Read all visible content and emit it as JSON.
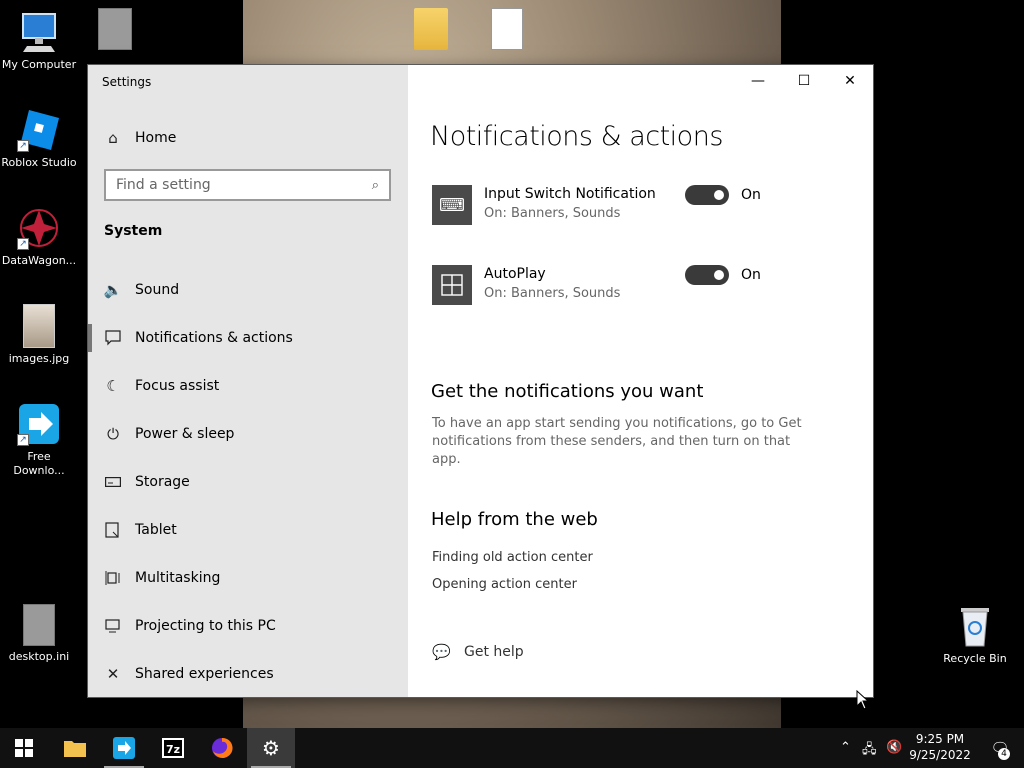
{
  "desktop": {
    "icons": [
      {
        "label": "My Computer"
      },
      {
        "label": "Roblox Studio"
      },
      {
        "label": "DataWagon..."
      },
      {
        "label": "images.jpg"
      },
      {
        "label": "Free Downlo..."
      },
      {
        "label": "desktop.ini"
      },
      {
        "label": "Recycle Bin"
      }
    ]
  },
  "window": {
    "title": "Settings",
    "controls": {
      "minimize": "—",
      "maximize": "☐",
      "close": "✕"
    }
  },
  "sidebar": {
    "home": "Home",
    "search_placeholder": "Find a setting",
    "section": "System",
    "items": [
      {
        "label": "Sound",
        "icon": "speaker-icon"
      },
      {
        "label": "Notifications & actions",
        "icon": "notification-icon",
        "selected": true
      },
      {
        "label": "Focus assist",
        "icon": "moon-icon"
      },
      {
        "label": "Power & sleep",
        "icon": "power-icon"
      },
      {
        "label": "Storage",
        "icon": "storage-icon"
      },
      {
        "label": "Tablet",
        "icon": "tablet-icon"
      },
      {
        "label": "Multitasking",
        "icon": "multitasking-icon"
      },
      {
        "label": "Projecting to this PC",
        "icon": "projecting-icon"
      },
      {
        "label": "Shared experiences",
        "icon": "shared-icon"
      }
    ]
  },
  "content": {
    "title": "Notifications & actions",
    "senders": [
      {
        "name": "Input Switch Notification",
        "detail": "On: Banners, Sounds",
        "state": "On"
      },
      {
        "name": "AutoPlay",
        "detail": "On: Banners, Sounds",
        "state": "On"
      }
    ],
    "get_notifications_heading": "Get the notifications you want",
    "get_notifications_text": "To have an app start sending you notifications, go to Get notifications from these senders, and then turn on that app.",
    "help_heading": "Help from the web",
    "help_links": [
      "Finding old action center",
      "Opening action center"
    ],
    "get_help": "Get help"
  },
  "taskbar": {
    "time": "9:25 PM",
    "date": "9/25/2022",
    "notification_count": "4"
  }
}
